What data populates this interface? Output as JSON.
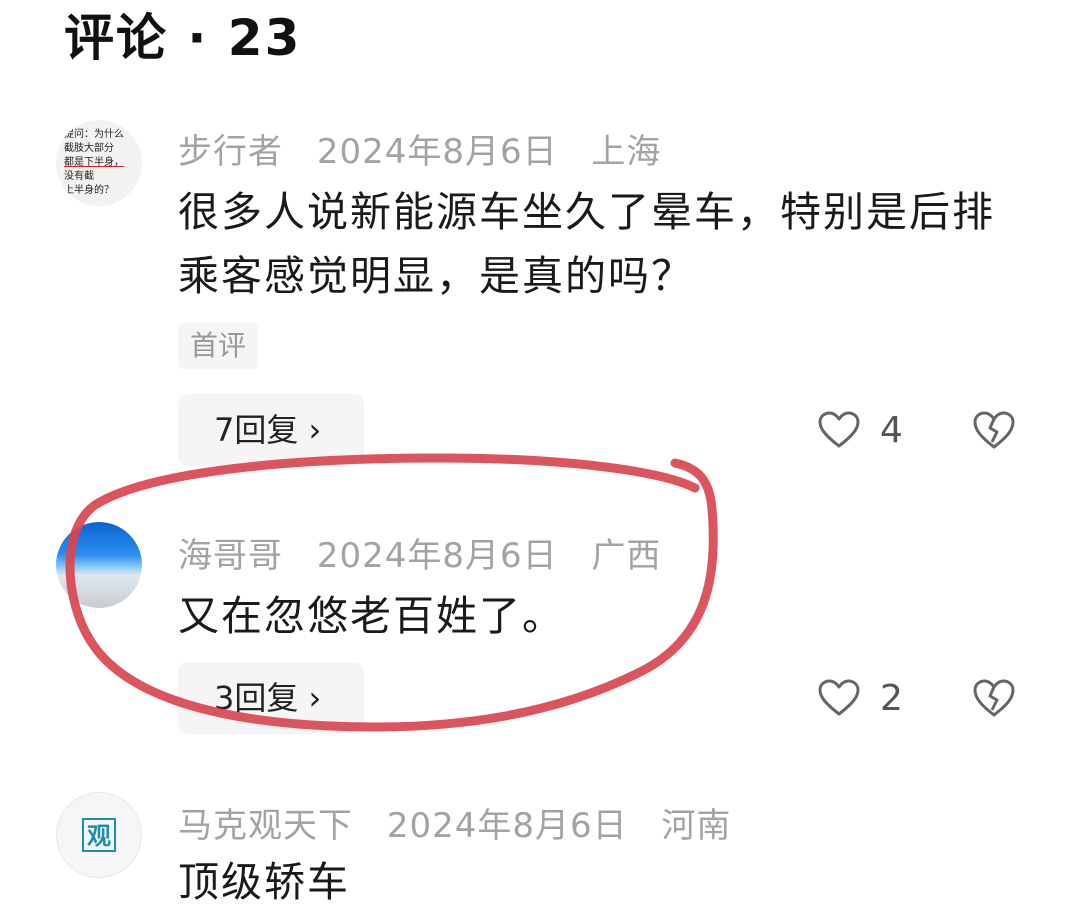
{
  "header": {
    "title": "评论 · 23"
  },
  "comments": [
    {
      "username": "步行者",
      "date": "2024年8月6日",
      "location": "上海",
      "text": "很多人说新能源车坐久了晕车，特别是后排乘客感觉明显，是真的吗？",
      "tag": "首评",
      "replies_label": "7回复 ›",
      "likes": "4",
      "avatar_lines": [
        "提问：为什么",
        "截肢大部分",
        "都是下半身，",
        "没有截",
        "上半身的？"
      ]
    },
    {
      "username": "海哥哥",
      "date": "2024年8月6日",
      "location": "广西",
      "text": "又在忽悠老百姓了。",
      "replies_label": "3回复 ›",
      "likes": "2"
    },
    {
      "username": "马克观天下",
      "date": "2024年8月6日",
      "location": "河南",
      "text": "顶级轿车",
      "avatar_glyph": "观"
    }
  ],
  "colors": {
    "meta_gray": "#a3a3a3",
    "annotation_red": "#d9454f",
    "avatar_accent": "#1f8fa6"
  },
  "icons": [
    "heart-outline-icon",
    "broken-heart-icon",
    "chevron-right-icon"
  ]
}
